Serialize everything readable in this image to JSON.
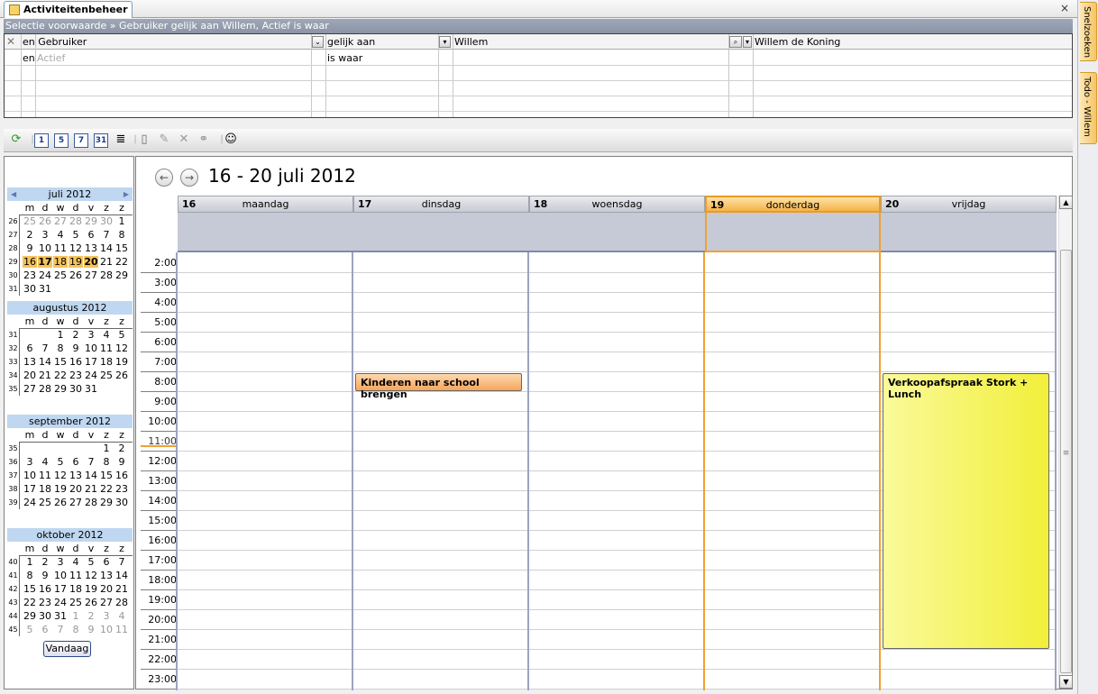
{
  "tab": {
    "title": "Activiteitenbeheer",
    "close": "×"
  },
  "filter": {
    "header": "Selectie voorwaarde » Gebruiker gelijk aan Willem, Actief is waar",
    "col1": "en Gebruiker",
    "col2": "gelijk aan",
    "col3": "Willem",
    "col4": "Willem de Koning",
    "row2_and": "en",
    "row2_field": "Actief",
    "row2_value": "is waar"
  },
  "toolbar": {
    "b1": "1",
    "b5": "5",
    "b7": "7",
    "b31": "31"
  },
  "title": "16 - 20 juli 2012",
  "nav": {
    "prev": "←",
    "next": "→"
  },
  "days": [
    {
      "num": "16",
      "name": "maandag"
    },
    {
      "num": "17",
      "name": "dinsdag"
    },
    {
      "num": "18",
      "name": "woensdag"
    },
    {
      "num": "19",
      "name": "donderdag"
    },
    {
      "num": "20",
      "name": "vrijdag"
    }
  ],
  "times": [
    "2:00",
    "3:00",
    "4:00",
    "5:00",
    "6:00",
    "7:00",
    "8:00",
    "9:00",
    "10:00",
    "11:00",
    "12:00",
    "13:00",
    "14:00",
    "15:00",
    "16:00",
    "17:00",
    "18:00",
    "19:00",
    "20:00",
    "21:00",
    "22:00",
    "23:00"
  ],
  "appointments": [
    {
      "title": "Kinderen naar school brengen",
      "day": "17",
      "start": "8:00",
      "color": "#f7a55b"
    },
    {
      "title": "Verkoopafspraak Stork + Lunch",
      "day": "20",
      "start": "8:00",
      "end": "21:00",
      "color": "#f1ef3a"
    }
  ],
  "mini": {
    "dow": [
      "m",
      "d",
      "w",
      "d",
      "v",
      "z",
      "z"
    ],
    "months": [
      {
        "title": "juli 2012",
        "weeks": [
          {
            "wk": "26",
            "days": [
              "25",
              "26",
              "27",
              "28",
              "29",
              "30",
              "1"
            ],
            "dim": [
              1,
              1,
              1,
              1,
              1,
              1,
              0
            ]
          },
          {
            "wk": "27",
            "days": [
              "2",
              "3",
              "4",
              "5",
              "6",
              "7",
              "8"
            ]
          },
          {
            "wk": "28",
            "days": [
              "9",
              "10",
              "11",
              "12",
              "13",
              "14",
              "15"
            ]
          },
          {
            "wk": "29",
            "days": [
              "16",
              "17",
              "18",
              "19",
              "20",
              "21",
              "22"
            ],
            "sel": [
              1,
              1,
              1,
              1,
              1,
              0,
              0
            ],
            "bold": [
              0,
              1,
              0,
              0,
              1,
              0,
              0
            ]
          },
          {
            "wk": "30",
            "days": [
              "23",
              "24",
              "25",
              "26",
              "27",
              "28",
              "29"
            ]
          },
          {
            "wk": "31",
            "days": [
              "30",
              "31",
              "",
              "",
              "",
              "",
              ""
            ]
          }
        ]
      },
      {
        "title": "augustus 2012",
        "weeks": [
          {
            "wk": "31",
            "days": [
              "",
              "",
              "1",
              "2",
              "3",
              "4",
              "5"
            ]
          },
          {
            "wk": "32",
            "days": [
              "6",
              "7",
              "8",
              "9",
              "10",
              "11",
              "12"
            ]
          },
          {
            "wk": "33",
            "days": [
              "13",
              "14",
              "15",
              "16",
              "17",
              "18",
              "19"
            ]
          },
          {
            "wk": "34",
            "days": [
              "20",
              "21",
              "22",
              "23",
              "24",
              "25",
              "26"
            ]
          },
          {
            "wk": "35",
            "days": [
              "27",
              "28",
              "29",
              "30",
              "31",
              "",
              ""
            ]
          }
        ]
      },
      {
        "title": "september 2012",
        "weeks": [
          {
            "wk": "35",
            "days": [
              "",
              "",
              "",
              "",
              "",
              "1",
              "2"
            ]
          },
          {
            "wk": "36",
            "days": [
              "3",
              "4",
              "5",
              "6",
              "7",
              "8",
              "9"
            ]
          },
          {
            "wk": "37",
            "days": [
              "10",
              "11",
              "12",
              "13",
              "14",
              "15",
              "16"
            ]
          },
          {
            "wk": "38",
            "days": [
              "17",
              "18",
              "19",
              "20",
              "21",
              "22",
              "23"
            ]
          },
          {
            "wk": "39",
            "days": [
              "24",
              "25",
              "26",
              "27",
              "28",
              "29",
              "30"
            ]
          }
        ]
      },
      {
        "title": "oktober 2012",
        "weeks": [
          {
            "wk": "40",
            "days": [
              "1",
              "2",
              "3",
              "4",
              "5",
              "6",
              "7"
            ]
          },
          {
            "wk": "41",
            "days": [
              "8",
              "9",
              "10",
              "11",
              "12",
              "13",
              "14"
            ]
          },
          {
            "wk": "42",
            "days": [
              "15",
              "16",
              "17",
              "18",
              "19",
              "20",
              "21"
            ]
          },
          {
            "wk": "43",
            "days": [
              "22",
              "23",
              "24",
              "25",
              "26",
              "27",
              "28"
            ]
          },
          {
            "wk": "44",
            "days": [
              "29",
              "30",
              "31",
              "1",
              "2",
              "3",
              "4"
            ],
            "dim": [
              0,
              0,
              0,
              1,
              1,
              1,
              1
            ]
          },
          {
            "wk": "45",
            "days": [
              "5",
              "6",
              "7",
              "8",
              "9",
              "10",
              "11"
            ],
            "dim": [
              1,
              1,
              1,
              1,
              1,
              1,
              1
            ]
          }
        ]
      }
    ],
    "today_button": "Vandaag"
  },
  "sidebar": {
    "tab1": "Snelzoeken",
    "tab2": "Todo - Willem"
  }
}
